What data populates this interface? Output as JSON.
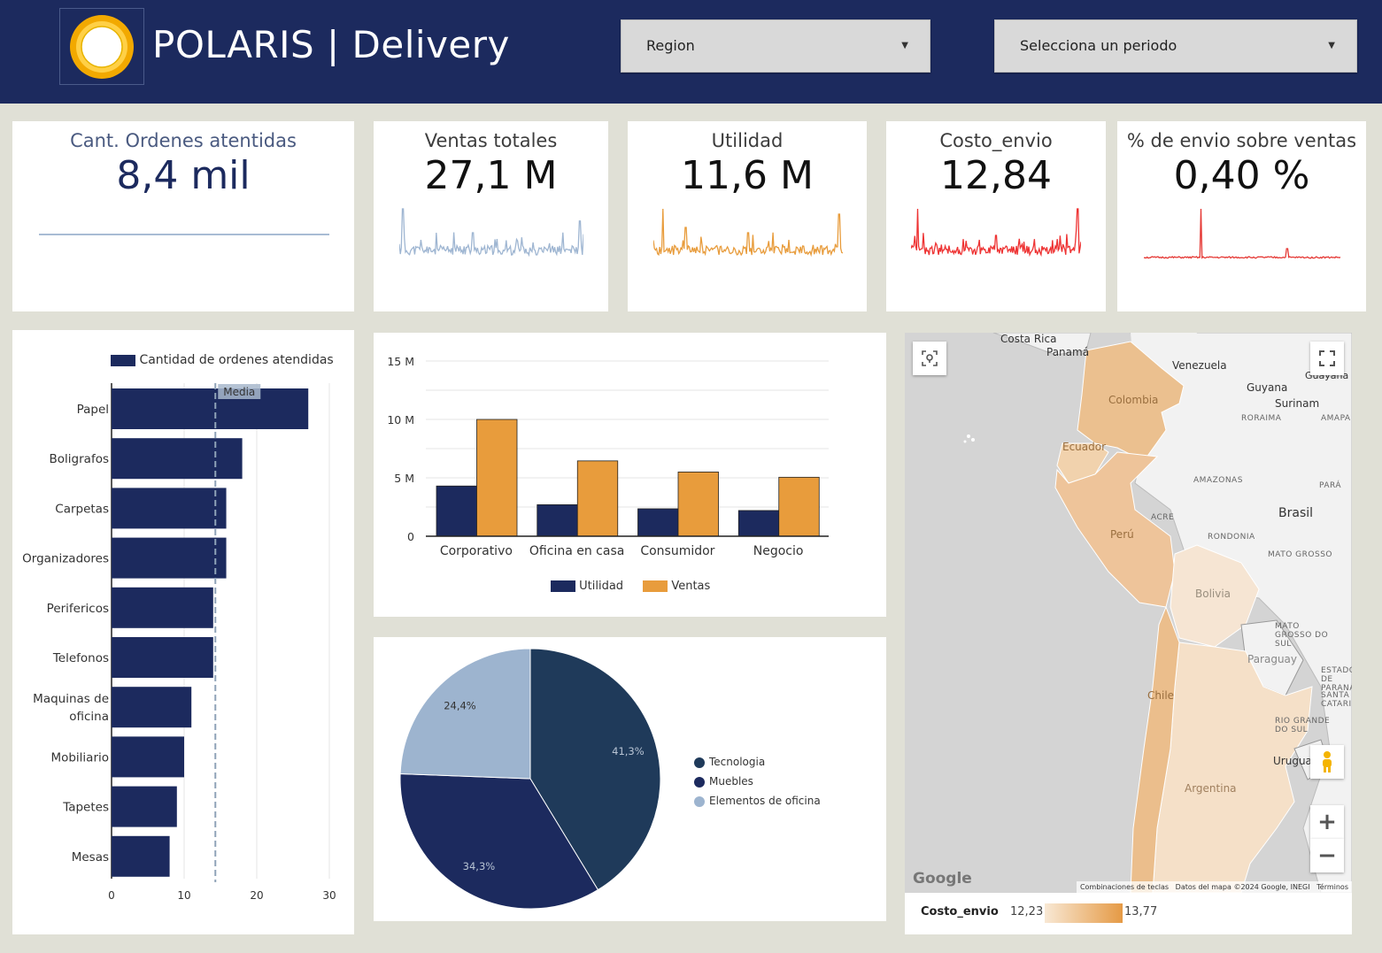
{
  "header": {
    "title": "POLARIS | Delivery",
    "filters": [
      {
        "label": "Region"
      },
      {
        "label": "Selecciona un periodo"
      }
    ]
  },
  "kpis": [
    {
      "label": "Cant. Ordenes atentidas",
      "value": "8,4 mil",
      "spark_color": "#a8bcd4"
    },
    {
      "label": "Ventas totales",
      "value": "27,1 M",
      "spark_color": "#9fb6d2"
    },
    {
      "label": "Utilidad",
      "value": "11,6 M",
      "spark_color": "#e89c3c"
    },
    {
      "label": "Costo_envio",
      "value": "12,84",
      "spark_color": "#ee3333"
    },
    {
      "label": "% de envio sobre ventas",
      "value": "0,40 %",
      "spark_color": "#e53935"
    }
  ],
  "chart_data": [
    {
      "type": "bar",
      "orientation": "horizontal",
      "legend": "Cantidad de ordenes atendidas",
      "categories": [
        "Papel",
        "Boligrafos",
        "Carpetas",
        "Organizadores",
        "Perifericos",
        "Telefonos",
        "Maquinas de oficina",
        "Mobiliario",
        "Tapetes",
        "Mesas"
      ],
      "category_lines": [
        [
          "Papel"
        ],
        [
          "Boligrafos"
        ],
        [
          "Carpetas"
        ],
        [
          "Organizadores"
        ],
        [
          "Perifericos"
        ],
        [
          "Telefonos"
        ],
        [
          "Maquinas de",
          "oficina"
        ],
        [
          "Mobiliario"
        ],
        [
          "Tapetes"
        ],
        [
          "Mesas"
        ]
      ],
      "values": [
        27.1,
        18,
        15.8,
        15.8,
        14,
        14,
        11,
        10,
        9,
        8
      ],
      "reference_line": {
        "label": "Media",
        "value": 14.3
      },
      "xlim": [
        0,
        30
      ],
      "xticks": [
        0,
        10,
        20,
        30
      ],
      "color": "#1c2a5e"
    },
    {
      "type": "bar",
      "categories": [
        "Corporativo",
        "Oficina en casa",
        "Consumidor",
        "Negocio"
      ],
      "series": [
        {
          "name": "Utilidad",
          "color": "#1c2a5e",
          "values": [
            4.3,
            2.7,
            2.35,
            2.2
          ]
        },
        {
          "name": "Ventas",
          "color": "#e89c3c",
          "values": [
            10,
            6.45,
            5.5,
            5.05
          ]
        }
      ],
      "ylim": [
        0,
        15
      ],
      "yticks": [
        {
          "v": 0,
          "label": "0"
        },
        {
          "v": 5,
          "label": "5 M"
        },
        {
          "v": 10,
          "label": "10 M"
        },
        {
          "v": 15,
          "label": "15 M"
        }
      ],
      "ygrid": [
        2.5,
        5,
        7.5,
        10,
        12.5,
        15
      ],
      "legend": "bottom"
    },
    {
      "type": "pie",
      "slices": [
        {
          "label": "Tecnologia",
          "value": 41.3,
          "text": "41,3%",
          "color": "#1f3a5a"
        },
        {
          "label": "Muebles",
          "value": 34.3,
          "text": "34,3%",
          "color": "#1c2a5e"
        },
        {
          "label": "Elementos de oficina",
          "value": 24.4,
          "text": "24,4%",
          "color": "#9db4cf"
        }
      ],
      "legend": "right"
    }
  ],
  "map": {
    "countries": [
      "Colombia",
      "Ecuador",
      "Perú",
      "Bolivia",
      "Paraguay",
      "Chile",
      "Argentina",
      "Brasil",
      "Venezuela",
      "Guyana",
      "Surinam",
      "Guayana Francesa",
      "Costa Rica",
      "Panamá",
      "Uruguay"
    ],
    "regions": [
      "RORAIMA",
      "AMAPA",
      "AMAZONAS",
      "PARÁ",
      "ACRE",
      "RONDONIA",
      "MATO GROSSO",
      "MATO GROSSO DO SUL",
      "ESTADO DE PARANÁ",
      "SANTA CATARINA",
      "RIO GRANDE DO SUL"
    ],
    "attribution": [
      "Combinaciones de teclas",
      "Datos del mapa ©2024 Google, INEGI",
      "Términos"
    ],
    "google": "Google",
    "legend": {
      "title": "Costo_envio",
      "min": "12,23",
      "max": "13,77",
      "color_low": "#f8e8d4",
      "color_high": "#e59a45"
    },
    "zoom_in": "+",
    "zoom_out": "−"
  }
}
